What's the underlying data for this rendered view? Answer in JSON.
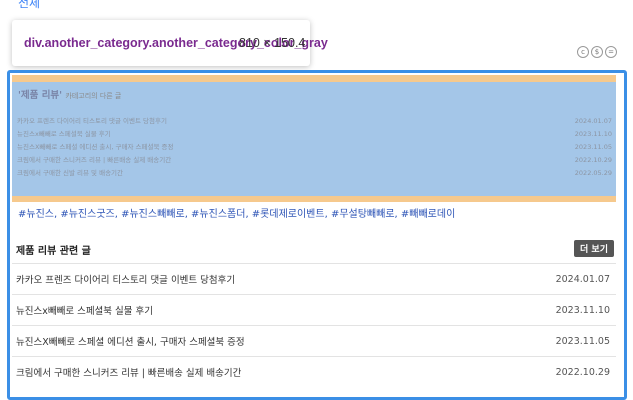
{
  "top_link": "전체",
  "inspector_tooltip": {
    "selector": "div.another_category.another_category_color_gray",
    "dimensions": "810 × 150.4"
  },
  "license_icons": [
    "cc-icon",
    "nc-icon",
    "nd-icon"
  ],
  "another_category": {
    "title_quote": "'제품 리뷰'",
    "title_suffix": "카테고리의 다른 글",
    "items": [
      {
        "title": "카카오 프렌즈 다이어리 티스토리 댓글 이벤트 당첨후기",
        "date": "2024.01.07"
      },
      {
        "title": "뉴진스x빼빼로 스페셜북 실물 후기",
        "date": "2023.11.10"
      },
      {
        "title": "뉴진스X빼빼로 스페셜 에디션 출시, 구매자 스페셜북 증정",
        "date": "2023.11.05"
      },
      {
        "title": "크림에서 구매한 스니커즈 리뷰 | 빠른배송 실제 배송기간",
        "date": "2022.10.29"
      },
      {
        "title": "크림에서 구매한 신발 리뷰 및 배송기간",
        "date": "2022.05.29"
      }
    ]
  },
  "tags": [
    "#뉴진스",
    "#뉴진스굿즈",
    "#뉴진스빼빼로",
    "#뉴진스폼더",
    "#롯데제로이벤트",
    "#무설탕빼빼로",
    "#빼빼로데이"
  ],
  "related": {
    "title": "제품 리뷰 관련 글",
    "more_label": "더 보기",
    "items": [
      {
        "title": "카카오 프렌즈 다이어리 티스토리 댓글 이벤트 당첨후기",
        "date": "2024.01.07"
      },
      {
        "title": "뉴진스x빼빼로 스페셜북 실물 후기",
        "date": "2023.11.10"
      },
      {
        "title": "뉴진스X빼빼로 스페셜 에디션 출시, 구매자 스페셜북 증정",
        "date": "2023.11.05"
      },
      {
        "title": "크림에서 구매한 스니커즈 리뷰 | 빠른배송 실제 배송기간",
        "date": "2022.10.29"
      }
    ]
  },
  "colors": {
    "highlight_border": "#3b8fe6",
    "overlay_fill": "#a4c6e8",
    "padding_fill": "#f6c98d",
    "tag_color": "#2f56b7"
  }
}
